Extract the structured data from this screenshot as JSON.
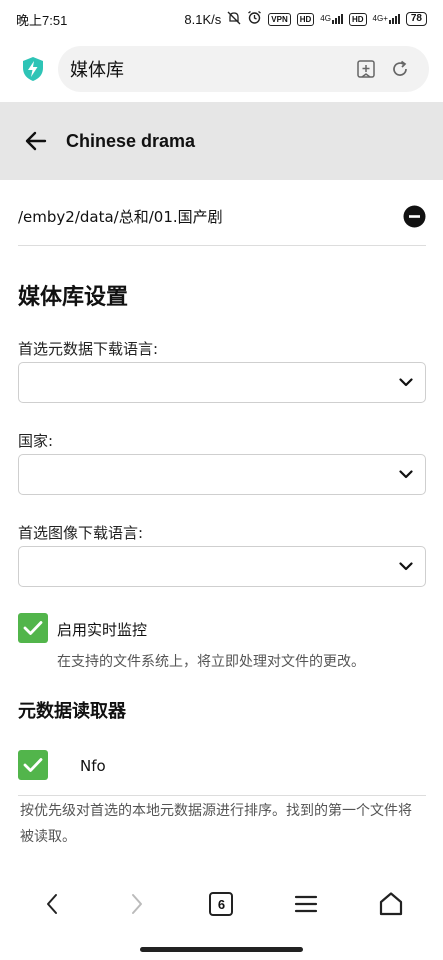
{
  "status_bar": {
    "time": "晚上7:51",
    "speed": "8.1K/s",
    "vpn": "VPN",
    "hd1": "HD",
    "net1": "4G",
    "hd2": "HD",
    "net2": "4G+",
    "battery": "78"
  },
  "browser": {
    "url_text": "媒体库",
    "tab_count": "6",
    "icons": {
      "shield": "shield-bolt-icon",
      "bookmark": "bookmark-add-icon",
      "reload": "reload-icon"
    }
  },
  "header": {
    "title": "Chinese drama"
  },
  "folder": {
    "path": "/emby2/data/总和/01.国产剧"
  },
  "settings": {
    "section_title": "媒体库设置",
    "metadata_language_label": "首选元数据下载语言:",
    "metadata_language_value": "",
    "country_label": "国家:",
    "country_value": "",
    "image_language_label": "首选图像下载语言:",
    "image_language_value": "",
    "realtime_label": "启用实时监控",
    "realtime_desc": "在支持的文件系统上，将立即处理对文件的更改。",
    "realtime_checked": true
  },
  "readers": {
    "section_title": "元数据读取器",
    "items": [
      {
        "label": "Nfo",
        "checked": true
      }
    ],
    "desc": "按优先级对首选的本地元数据源进行排序。找到的第一个文件将被读取。"
  },
  "colors": {
    "accent_green": "#52b54b",
    "shield_teal": "#2ec4b6",
    "header_bg": "#e6e6e6"
  }
}
